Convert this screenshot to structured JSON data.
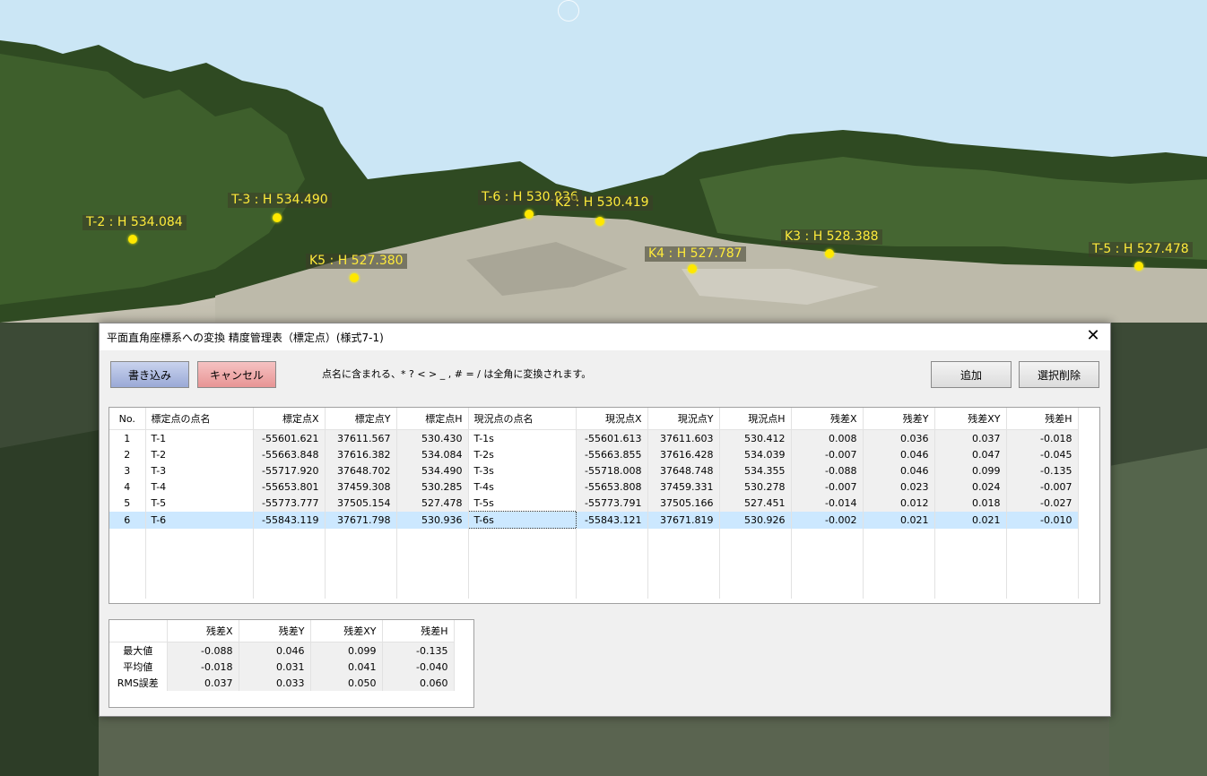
{
  "scene": {
    "markers": [
      {
        "label": "T-2 : H 534.084"
      },
      {
        "label": "T-3 : H 534.490"
      },
      {
        "label": "T-6 : H 530.936"
      },
      {
        "label": "K2 : H 530.419"
      },
      {
        "label": "K5 : H 527.380"
      },
      {
        "label": "K4 : H 527.787"
      },
      {
        "label": "K3 : H 528.388"
      },
      {
        "label": "T-5 : H 527.478"
      }
    ],
    "colors": {
      "sky": "#c8e4f3",
      "marker": "#ffe800",
      "foliage": "#2f4a22",
      "ground": "#b9b6a8"
    }
  },
  "dialog": {
    "title": "平面直角座標系への変換 精度管理表（標定点）(様式7-1)",
    "close_icon": "close-icon",
    "buttons": {
      "write": "書き込み",
      "cancel": "キャンセル",
      "add": "追加",
      "delete_selected": "選択削除"
    },
    "notice": "点名に含まれる、* ? < > _ , # = / は全角に変換されます。",
    "colors": {
      "write_button": "#9aa9d6",
      "cancel_button": "#e79595",
      "selected_row": "#cce8ff"
    }
  },
  "table": {
    "headers": [
      "No.",
      "標定点の点名",
      "標定点X",
      "標定点Y",
      "標定点H",
      "現況点の点名",
      "現況点X",
      "現況点Y",
      "現況点H",
      "残差X",
      "残差Y",
      "残差XY",
      "残差H"
    ],
    "rows": [
      [
        "1",
        "T-1",
        "-55601.621",
        "37611.567",
        "530.430",
        "T-1s",
        "-55601.613",
        "37611.603",
        "530.412",
        "0.008",
        "0.036",
        "0.037",
        "-0.018"
      ],
      [
        "2",
        "T-2",
        "-55663.848",
        "37616.382",
        "534.084",
        "T-2s",
        "-55663.855",
        "37616.428",
        "534.039",
        "-0.007",
        "0.046",
        "0.047",
        "-0.045"
      ],
      [
        "3",
        "T-3",
        "-55717.920",
        "37648.702",
        "534.490",
        "T-3s",
        "-55718.008",
        "37648.748",
        "534.355",
        "-0.088",
        "0.046",
        "0.099",
        "-0.135"
      ],
      [
        "4",
        "T-4",
        "-55653.801",
        "37459.308",
        "530.285",
        "T-4s",
        "-55653.808",
        "37459.331",
        "530.278",
        "-0.007",
        "0.023",
        "0.024",
        "-0.007"
      ],
      [
        "5",
        "T-5",
        "-55773.777",
        "37505.154",
        "527.478",
        "T-5s",
        "-55773.791",
        "37505.166",
        "527.451",
        "-0.014",
        "0.012",
        "0.018",
        "-0.027"
      ],
      [
        "6",
        "T-6",
        "-55843.119",
        "37671.798",
        "530.936",
        "T-6s",
        "-55843.121",
        "37671.819",
        "530.926",
        "-0.002",
        "0.021",
        "0.021",
        "-0.010"
      ]
    ],
    "selected_row": 6
  },
  "summary": {
    "headers": [
      "残差X",
      "残差Y",
      "残差XY",
      "残差H"
    ],
    "rows": [
      {
        "label": "最大値",
        "values": [
          "-0.088",
          "0.046",
          "0.099",
          "-0.135"
        ]
      },
      {
        "label": "平均値",
        "values": [
          "-0.018",
          "0.031",
          "0.041",
          "-0.040"
        ]
      },
      {
        "label": "RMS誤差",
        "values": [
          "0.037",
          "0.033",
          "0.050",
          "0.060"
        ]
      }
    ]
  }
}
